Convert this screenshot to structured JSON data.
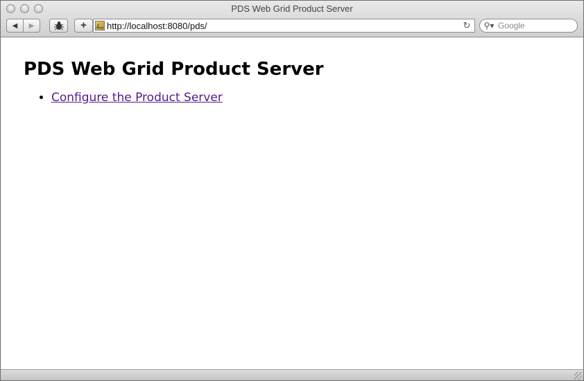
{
  "window": {
    "title": "PDS Web Grid Product Server"
  },
  "toolbar": {
    "back_icon": "back-arrow-icon",
    "forward_icon": "forward-arrow-icon",
    "bug_icon": "bug-icon",
    "add_icon": "plus-icon",
    "back_glyph": "◀",
    "forward_glyph": "▶",
    "add_glyph": "+",
    "url": "http://localhost:8080/pds/",
    "reload_glyph": "↻",
    "search_placeholder": "Google",
    "search_glyph": "⚲▾"
  },
  "page": {
    "heading": "PDS Web Grid Product Server",
    "links": [
      {
        "label": "Configure the Product Server"
      }
    ]
  },
  "colors": {
    "visited_link": "#551a8b"
  }
}
